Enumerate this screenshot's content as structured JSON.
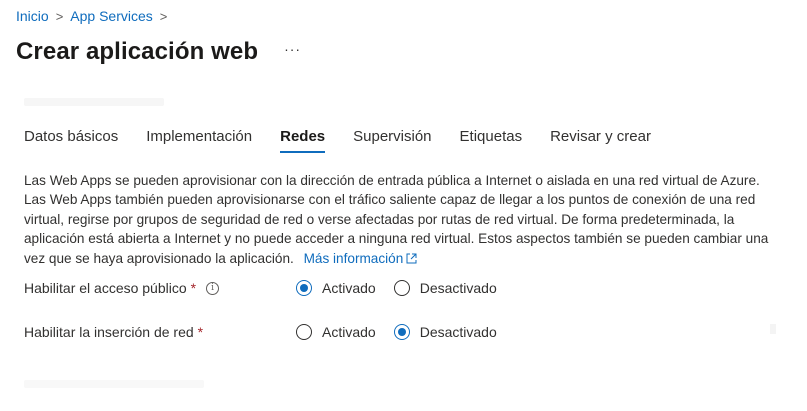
{
  "breadcrumb": {
    "items": [
      "Inicio",
      "App Services"
    ]
  },
  "page": {
    "title": "Crear aplicación web",
    "more_label": "···"
  },
  "tabs": [
    {
      "label": "Datos básicos",
      "active": false
    },
    {
      "label": "Implementación",
      "active": false
    },
    {
      "label": "Redes",
      "active": true
    },
    {
      "label": "Supervisión",
      "active": false
    },
    {
      "label": "Etiquetas",
      "active": false
    },
    {
      "label": "Revisar y crear",
      "active": false
    }
  ],
  "description": {
    "text": "Las Web Apps se pueden aprovisionar con la dirección de entrada pública a Internet o aislada en una red virtual de Azure. Las Web Apps también pueden aprovisionarse con el tráfico saliente capaz de llegar a los puntos de conexión de una red virtual, regirse por grupos de seguridad de red o verse afectadas por rutas de red virtual. De forma predeterminada, la aplicación está abierta a Internet y no puede acceder a ninguna red virtual. Estos aspectos también se pueden cambiar una vez que se haya aprovisionado la aplicación.",
    "link": "Más información",
    "link_icon": "external-link-icon"
  },
  "fields": {
    "public_access": {
      "label": "Habilitar el acceso público",
      "required_mark": "*",
      "info_icon": "info-icon",
      "options": [
        "Activado",
        "Desactivado"
      ],
      "selected": "Activado"
    },
    "network_injection": {
      "label": "Habilitar la inserción de red",
      "required_mark": "*",
      "options": [
        "Activado",
        "Desactivado"
      ],
      "selected": "Desactivado"
    }
  },
  "colors": {
    "accent": "#0f6cbd",
    "required": "#a4262c",
    "text": "#323130"
  }
}
